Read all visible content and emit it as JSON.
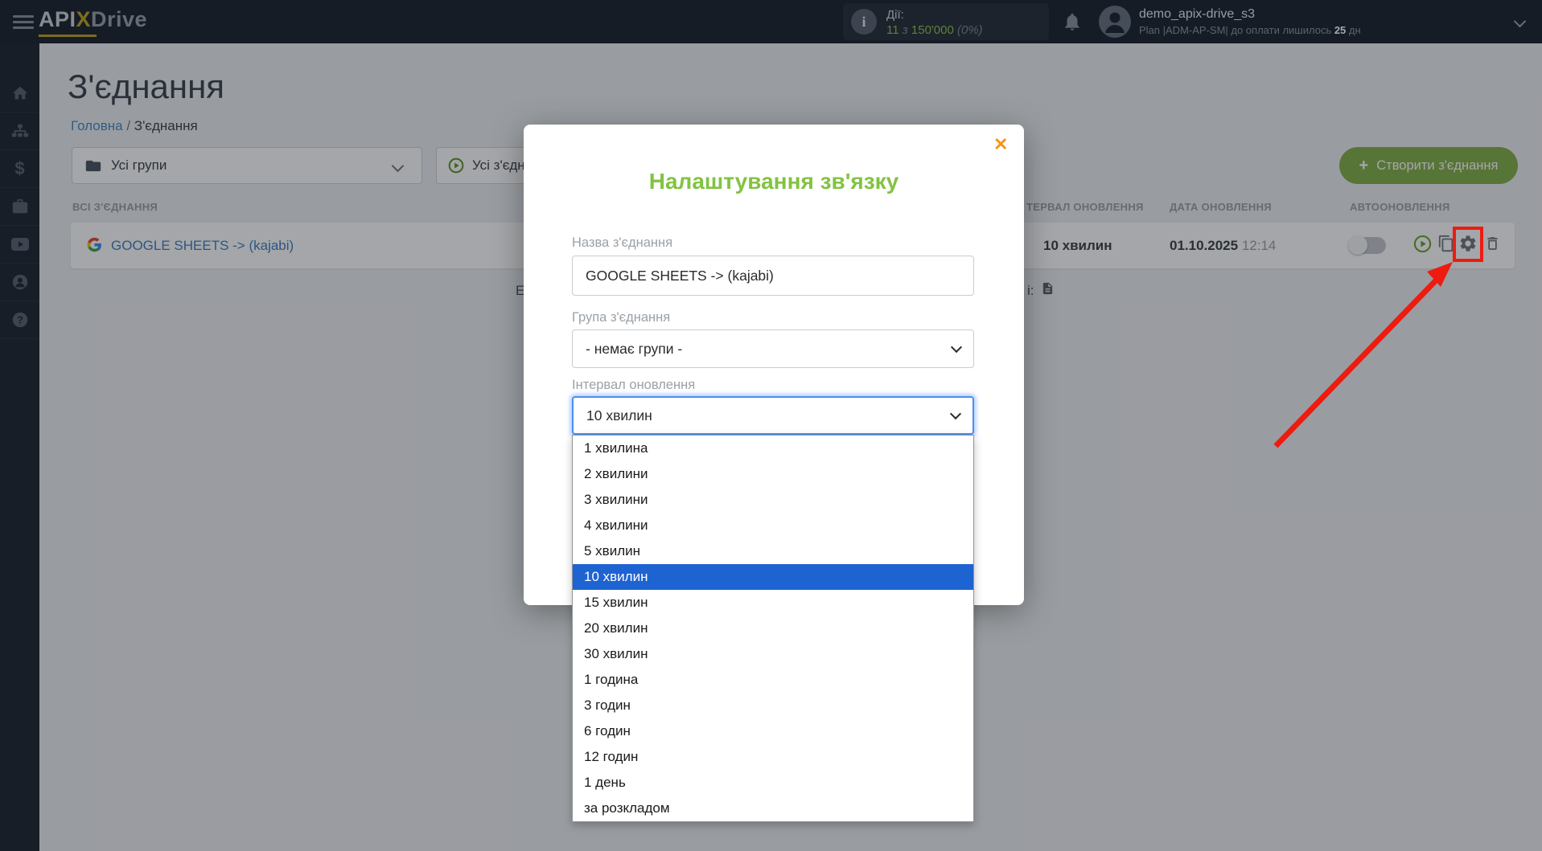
{
  "topbar": {
    "logo_api": "API",
    "logo_x": "X",
    "logo_drive": "Drive",
    "actions_label": "Дії:",
    "actions_used": "11",
    "actions_of": "з",
    "actions_total": "150'000",
    "actions_percent": "(0%)",
    "user_name": "demo_apix-drive_s3",
    "plan_prefix": "Plan |ADM-AP-SM| до оплати лишилось ",
    "plan_days": "25",
    "plan_suffix": " дн"
  },
  "page": {
    "title": "З'єднання",
    "breadcrumb_home": "Головна",
    "breadcrumb_sep": "/",
    "breadcrumb_current": "З'єднання"
  },
  "filters": {
    "groups_label": "Усі групи",
    "connections_label": "Усі з'єдна"
  },
  "create_button": {
    "plus": "+",
    "label": "Створити з'єднання"
  },
  "table": {
    "header_all": "ВСІ З'ЄДНАННЯ",
    "header_interval": "ТЕРВАЛ ОНОВЛЕННЯ",
    "header_date": "ДАТА ОНОВЛЕННЯ",
    "header_auto": "АВТООНОВЛЕННЯ",
    "row": {
      "name": "GOOGLE SHEETS -> (kajabi)",
      "interval": "10 хвилин",
      "date": "01.10.2025",
      "time": "12:14"
    }
  },
  "background_fragments": {
    "left": "Е",
    "right": "і:"
  },
  "modal": {
    "title": "Налаштування зв'язку",
    "close": "✕",
    "name_label": "Назва з'єднання",
    "name_value": "GOOGLE SHEETS -> (kajabi)",
    "group_label": "Група з'єднання",
    "group_value": "- немає групи -",
    "interval_label": "Інтервал оновлення",
    "interval_value": "10 хвилин",
    "interval_dropdown": {
      "selected_index": 5,
      "options": [
        "1 хвилина",
        "2 хвилини",
        "3 хвилини",
        "4 хвилини",
        "5 хвилин",
        "10 хвилин",
        "15 хвилин",
        "20 хвилин",
        "30 хвилин",
        "1 година",
        "3 годин",
        "6 годин",
        "12 годин",
        "1 день",
        "за розкладом"
      ]
    }
  },
  "colors": {
    "brand_green": "#84b147",
    "modal_title_green": "#82c341",
    "close_orange": "#f7941d",
    "selection_blue": "#1e63d2",
    "annotation_red": "#ee1b10",
    "link_blue": "#3f7fbf"
  }
}
